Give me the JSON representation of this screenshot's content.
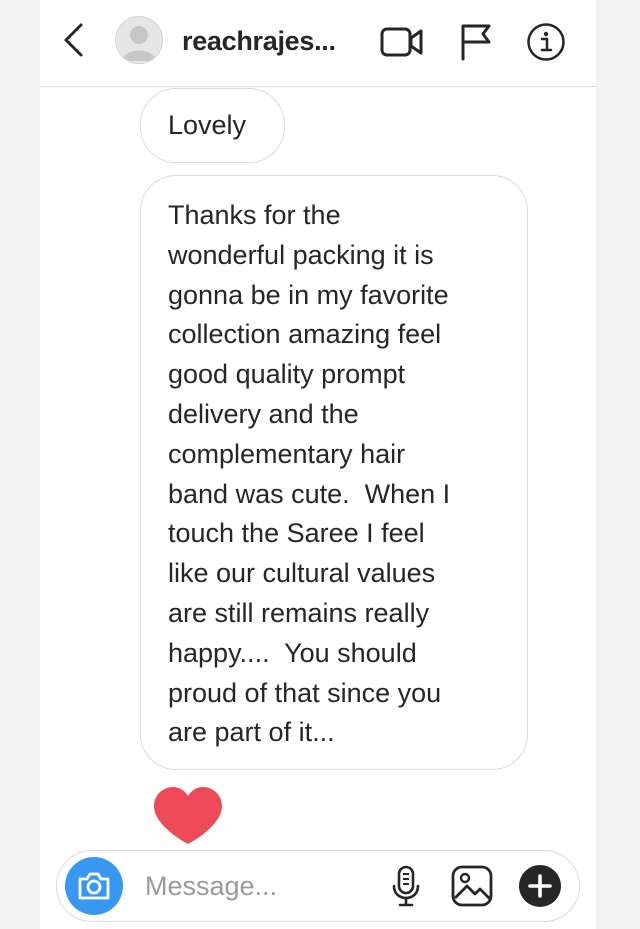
{
  "header": {
    "username": "reachrajes...",
    "back_icon": "chevron-left-icon",
    "video_icon": "video-camera-icon",
    "flag_icon": "flag-icon",
    "info_icon": "info-icon"
  },
  "messages": [
    {
      "text": "Lovely"
    },
    {
      "text": "Thanks for the\nwonderful packing it is\ngonna be in my favorite\ncollection amazing feel\ngood quality prompt\ndelivery and the\ncomplementary hair\nband was cute.  When I\ntouch the Saree I feel\nlike our cultural values\nare still remains really\nhappy....  You should\nproud of that since you\nare part of it..."
    }
  ],
  "reaction": {
    "icon": "heart-icon",
    "color": "#ed4956"
  },
  "composer": {
    "placeholder": "Message...",
    "camera_icon": "camera-icon",
    "mic_icon": "microphone-icon",
    "gallery_icon": "image-icon",
    "plus_icon": "plus-icon",
    "accent_color": "#3897f0"
  }
}
